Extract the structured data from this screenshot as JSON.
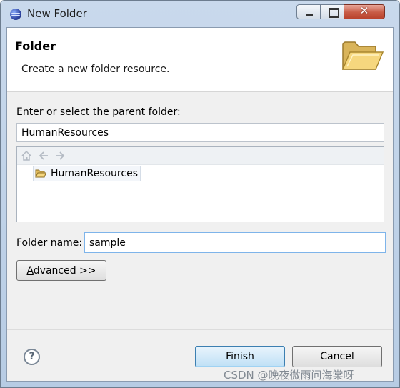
{
  "window": {
    "title": "New Folder",
    "close_glyph": "✕"
  },
  "banner": {
    "title": "Folder",
    "description": "Create a new folder resource."
  },
  "parent": {
    "label_prefix": "",
    "label_mnemonic": "E",
    "label_rest": "nter or select the parent folder:",
    "value": "HumanResources"
  },
  "tree": {
    "toolbar": [
      "home-icon",
      "back-arrow-icon",
      "forward-arrow-icon"
    ],
    "items": [
      {
        "label": "HumanResources",
        "icon": "open-folder-icon"
      }
    ]
  },
  "folder_name": {
    "label_prefix": "Folder ",
    "label_mnemonic": "n",
    "label_rest": "ame:",
    "value": "sample"
  },
  "buttons": {
    "advanced_mnemonic": "A",
    "advanced_rest": "dvanced >>",
    "finish": "Finish",
    "cancel": "Cancel"
  },
  "help": {
    "glyph": "?"
  },
  "watermark": "CSDN @晚夜微雨问海棠呀",
  "colors": {
    "accent": "#3c7fb1",
    "titlebar": "#c9d9ec",
    "close_button": "#c85b45"
  }
}
